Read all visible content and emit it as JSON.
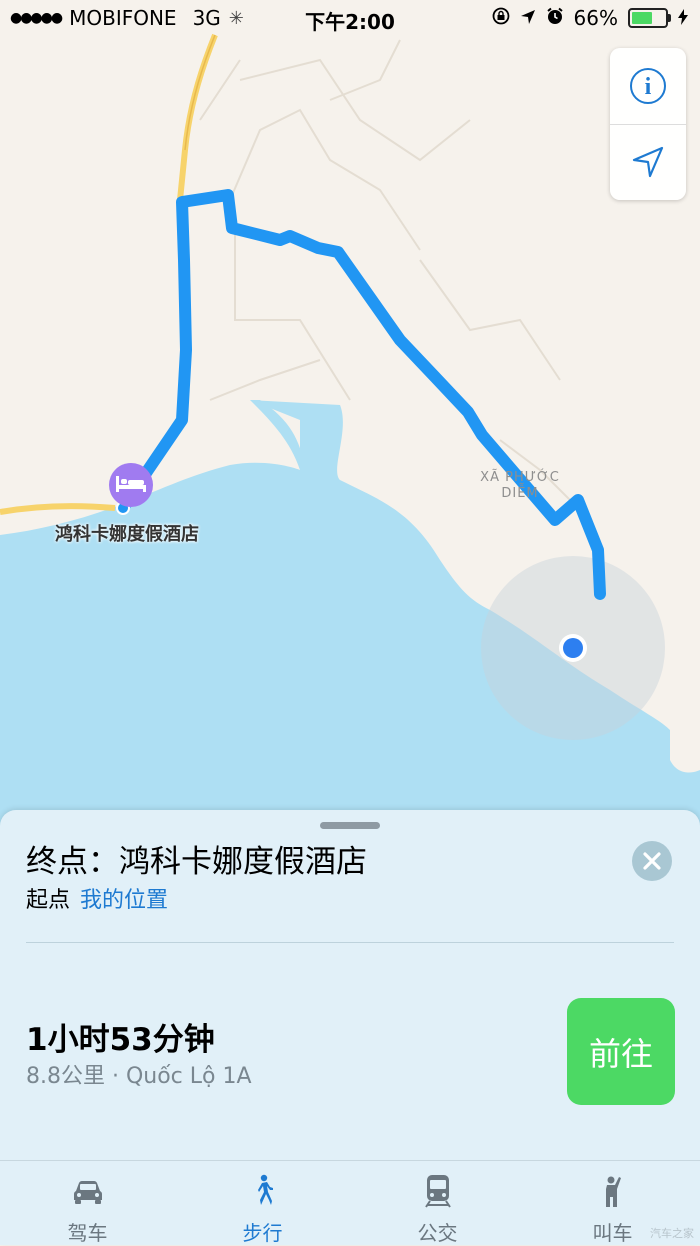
{
  "status_bar": {
    "signal": "●●●●●",
    "carrier": "MOBIFONE",
    "network": "3G",
    "time": "下午2:00",
    "battery_percent": "66%",
    "battery_level": 0.66
  },
  "map": {
    "hotel_label": "鸿科卡娜度假酒店",
    "area_label_line1": "XÃ PHƯỚC",
    "area_label_line2": "DIỄM",
    "info_icon": "info-icon",
    "locate_icon": "location-arrow-icon"
  },
  "sheet": {
    "destination": "终点：鸿科卡娜度假酒店",
    "origin_prefix": "起点",
    "origin_value": "我的位置",
    "duration": "1小时53分钟",
    "route_meta": "8.8公里 · Quốc Lộ 1A",
    "go_label": "前往"
  },
  "tabs": [
    {
      "label": "驾车",
      "icon": "car-icon",
      "active": false
    },
    {
      "label": "步行",
      "icon": "walk-icon",
      "active": true
    },
    {
      "label": "公交",
      "icon": "train-icon",
      "active": false
    },
    {
      "label": "叫车",
      "icon": "hail-icon",
      "active": false
    }
  ],
  "watermark": "汽车之家",
  "colors": {
    "route": "#2196f3",
    "water": "#aedff3",
    "land": "#f6f2ec",
    "accent": "#1e7ad1",
    "go": "#4cd964",
    "poi": "#a07bf0"
  }
}
